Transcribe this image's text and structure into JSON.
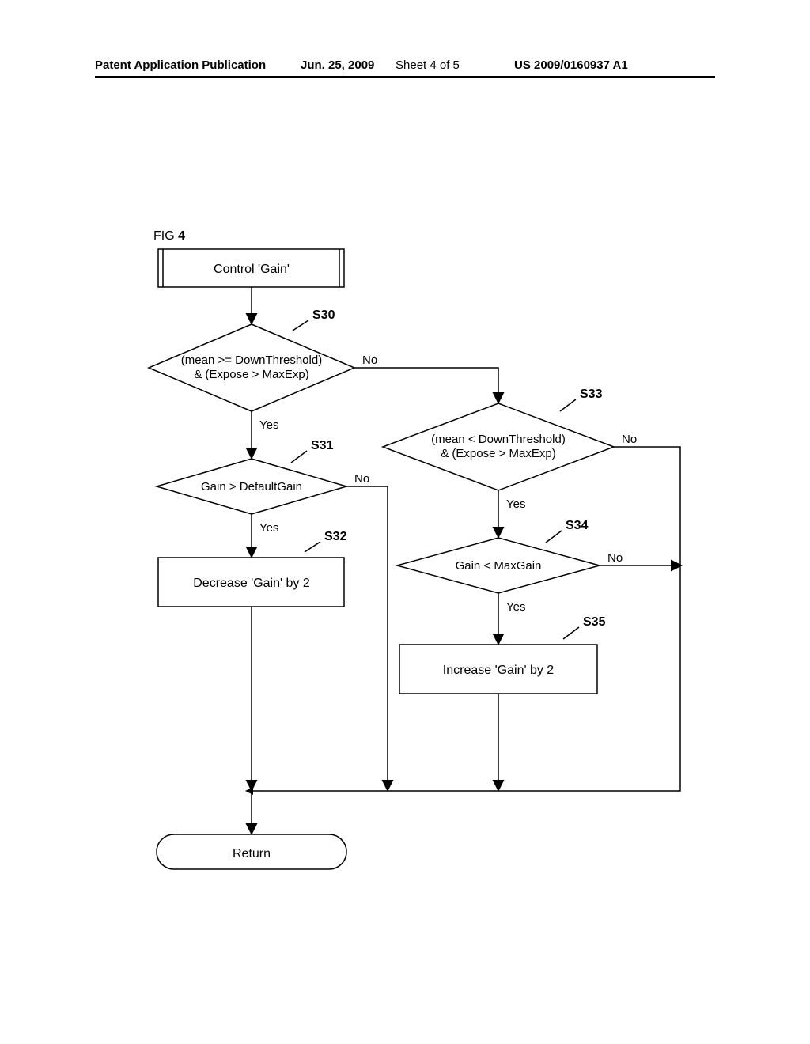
{
  "header": {
    "left": "Patent Application Publication",
    "date": "Jun. 25, 2009",
    "sheet": "Sheet 4 of 5",
    "pubno": "US 2009/0160937 A1"
  },
  "figure_label": "FIG 4",
  "nodes": {
    "n_start": {
      "text": "Control 'Gain'"
    },
    "s30": {
      "label": "S30",
      "line1": "(mean >= DownThreshold)",
      "line2": "& (Expose > MaxExp)"
    },
    "s31": {
      "label": "S31",
      "text": "Gain > DefaultGain"
    },
    "s32": {
      "label": "S32",
      "text": "Decrease 'Gain' by 2"
    },
    "s33": {
      "label": "S33",
      "line1": "(mean < DownThreshold)",
      "line2": "& (Expose > MaxExp)"
    },
    "s34": {
      "label": "S34",
      "text": "Gain < MaxGain"
    },
    "s35": {
      "label": "S35",
      "text": "Increase 'Gain' by 2"
    },
    "n_return": {
      "text": "Return"
    }
  },
  "edges": {
    "yes": "Yes",
    "no": "No"
  }
}
